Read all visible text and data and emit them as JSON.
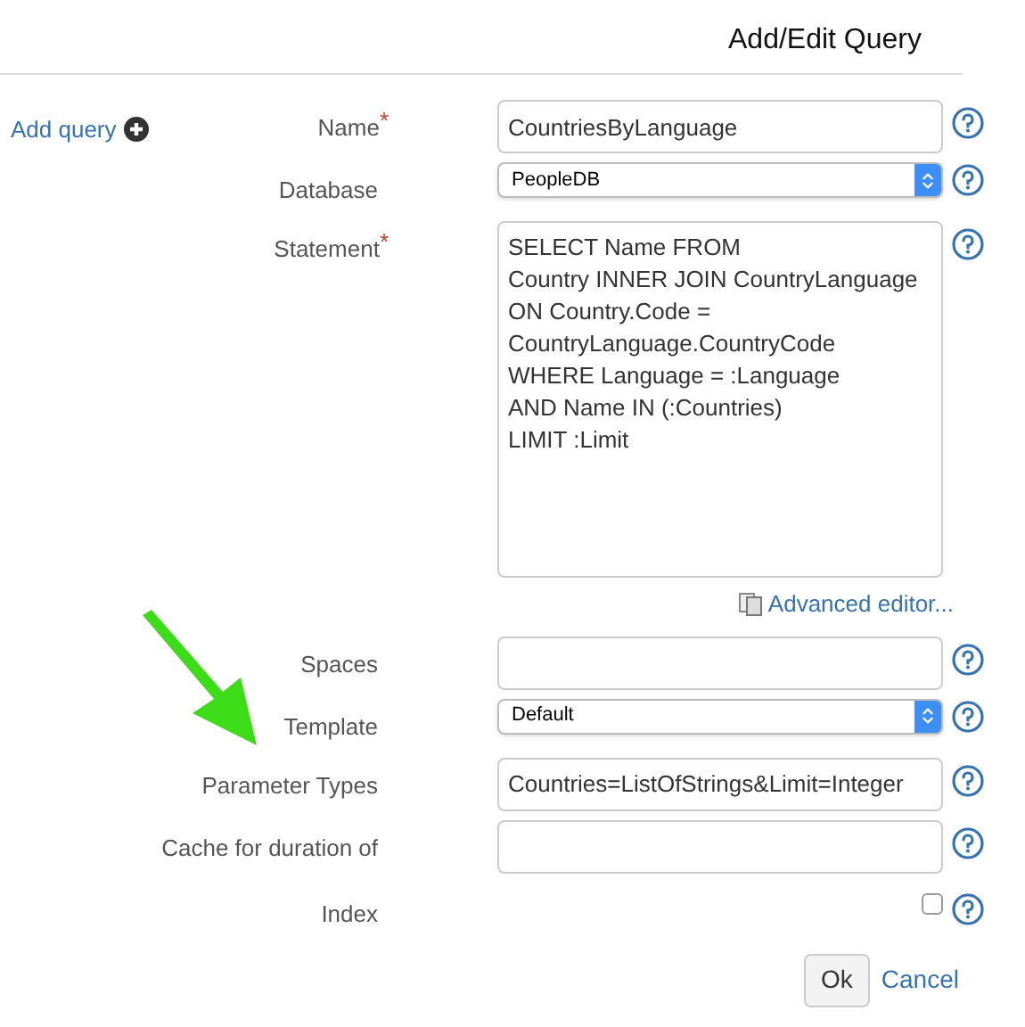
{
  "title": "Add/Edit Query",
  "sidebar": {
    "add_link": "Add query"
  },
  "fields": [
    {
      "kind": "text",
      "label": "Name",
      "required_mark": "*",
      "value": "CountriesByLanguage"
    },
    {
      "kind": "select",
      "label": "Database",
      "value": "PeopleDB"
    },
    {
      "kind": "textarea",
      "label": "Statement",
      "required_mark": "*",
      "value": "SELECT Name FROM\nCountry INNER JOIN CountryLanguage\nON Country.Code =\nCountryLanguage.CountryCode\nWHERE Language = :Language\nAND Name IN (:Countries)\nLIMIT :Limit",
      "link": "Advanced editor..."
    },
    {
      "kind": "text",
      "label": "Spaces"
    },
    {
      "kind": "select",
      "label": "Template",
      "value": "Default"
    },
    {
      "kind": "text",
      "label": "Parameter Types",
      "value": "Countries=ListOfStrings&Limit=Integer"
    },
    {
      "kind": "text",
      "label": "Cache for duration of"
    },
    {
      "kind": "checkbox",
      "label": "Index",
      "checked": false
    }
  ],
  "buttons": {
    "ok": "Ok",
    "cancel": "Cancel"
  }
}
